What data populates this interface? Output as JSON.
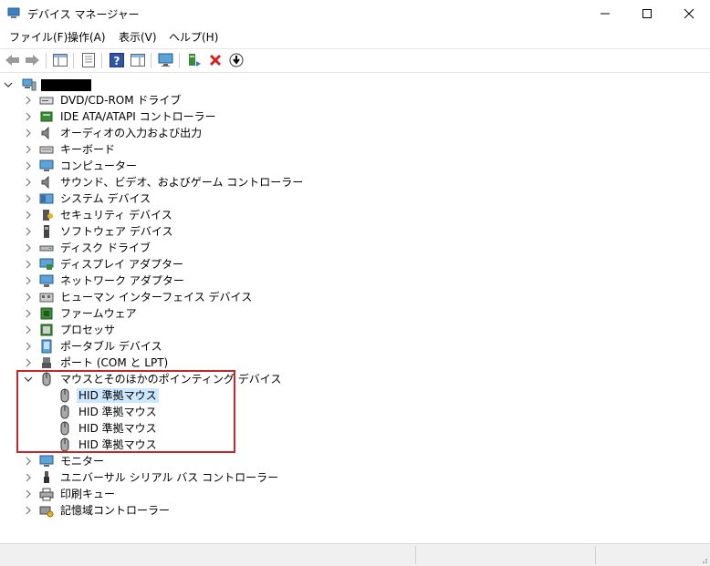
{
  "window": {
    "title": "デバイス マネージャー"
  },
  "menu": [
    {
      "label": "ファイル(F)"
    },
    {
      "label": "操作(A)"
    },
    {
      "label": "表示(V)"
    },
    {
      "label": "ヘルプ(H)"
    }
  ],
  "tree": {
    "categories": [
      {
        "label": "DVD/CD-ROM ドライブ",
        "icon": "dvd-drive-icon"
      },
      {
        "label": "IDE ATA/ATAPI コントローラー",
        "icon": "ide-controller-icon"
      },
      {
        "label": "オーディオの入力および出力",
        "icon": "speaker-icon"
      },
      {
        "label": "キーボード",
        "icon": "keyboard-icon"
      },
      {
        "label": "コンピューター",
        "icon": "computer-icon"
      },
      {
        "label": "サウンド、ビデオ、およびゲーム コントローラー",
        "icon": "speaker-icon"
      },
      {
        "label": "システム デバイス",
        "icon": "system-device-icon"
      },
      {
        "label": "セキュリティ デバイス",
        "icon": "security-device-icon"
      },
      {
        "label": "ソフトウェア デバイス",
        "icon": "software-device-icon"
      },
      {
        "label": "ディスク ドライブ",
        "icon": "disk-drive-icon"
      },
      {
        "label": "ディスプレイ アダプター",
        "icon": "display-adapter-icon"
      },
      {
        "label": "ネットワーク アダプター",
        "icon": "network-adapter-icon"
      },
      {
        "label": "ヒューマン インターフェイス デバイス",
        "icon": "hid-icon"
      },
      {
        "label": "ファームウェア",
        "icon": "firmware-icon"
      },
      {
        "label": "プロセッサ",
        "icon": "processor-icon"
      },
      {
        "label": "ポータブル デバイス",
        "icon": "portable-device-icon"
      },
      {
        "label": "ポート (COM と LPT)",
        "icon": "port-icon"
      },
      {
        "label": "マウスとそのほかのポインティング デバイス",
        "icon": "mouse-icon",
        "expanded": true
      },
      {
        "label": "HID 準拠マウス",
        "icon": "mouse-icon",
        "child": true,
        "selected": true
      },
      {
        "label": "HID 準拠マウス",
        "icon": "mouse-icon",
        "child": true
      },
      {
        "label": "HID 準拠マウス",
        "icon": "mouse-icon",
        "child": true
      },
      {
        "label": "HID 準拠マウス",
        "icon": "mouse-icon",
        "child": true
      },
      {
        "label": "モニター",
        "icon": "monitor-icon"
      },
      {
        "label": "ユニバーサル シリアル バス コントローラー",
        "icon": "usb-icon"
      },
      {
        "label": "印刷キュー",
        "icon": "printer-icon"
      },
      {
        "label": "記憶域コントローラー",
        "icon": "storage-controller-icon"
      }
    ]
  },
  "colors": {
    "selection": "#cce8ff",
    "highlight_border": "#c0282d"
  }
}
